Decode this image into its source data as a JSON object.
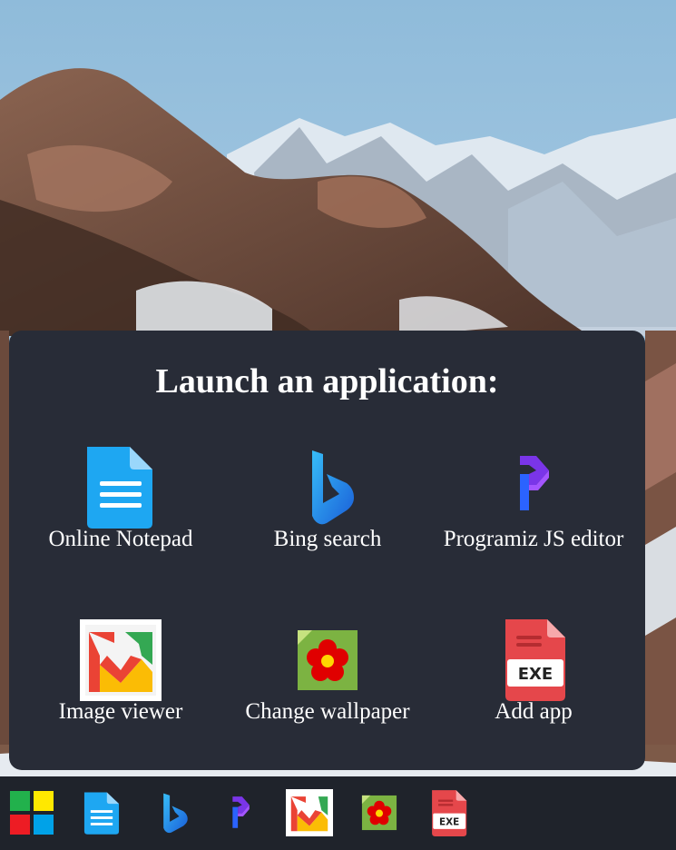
{
  "launcher": {
    "title": "Launch an application:",
    "apps": [
      {
        "label": "Online Notepad",
        "icon": "notepad-icon"
      },
      {
        "label": "Bing search",
        "icon": "bing-icon"
      },
      {
        "label": "Programiz JS editor",
        "icon": "programiz-icon"
      },
      {
        "label": "Image viewer",
        "icon": "image-viewer-icon"
      },
      {
        "label": "Change wallpaper",
        "icon": "wallpaper-icon"
      },
      {
        "label": "Add app",
        "icon": "exe-icon"
      }
    ]
  },
  "taskbar": {
    "items": [
      "start-icon",
      "notepad-icon",
      "bing-icon",
      "programiz-icon",
      "image-viewer-icon",
      "wallpaper-icon",
      "exe-icon"
    ],
    "exe_text": "EXE"
  },
  "colors": {
    "panel": "#282c37",
    "taskbar": "#1f232b",
    "sky": "#9cc3de"
  }
}
